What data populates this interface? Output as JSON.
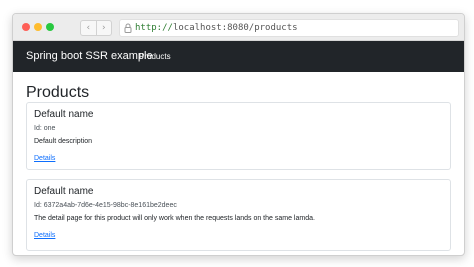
{
  "browser": {
    "url_scheme": "http://",
    "url_rest": "localhost:8080/products",
    "back_glyph": "‹",
    "forward_glyph": "›",
    "icons": [
      "back-icon",
      "forward-icon",
      "lock-icon"
    ]
  },
  "navbar": {
    "brand": "Spring boot SSR example",
    "link": "Products",
    "background": "#212529"
  },
  "page": {
    "title": "Products"
  },
  "products": [
    {
      "name": "Default name",
      "id_text": "Id: one",
      "description": "Default description",
      "link": "Details"
    },
    {
      "name": "Default name",
      "id_text": "Id: 6372a4ab-7d6e-4e15-98bc-8e161be2deec",
      "description": "The detail page for this product will only work when the requests lands on the same lamda.",
      "link": "Details"
    }
  ],
  "colors": {
    "link": "#0d6efd",
    "close": "#fe5f57",
    "minimize": "#febc2e",
    "zoom": "#28c840"
  }
}
